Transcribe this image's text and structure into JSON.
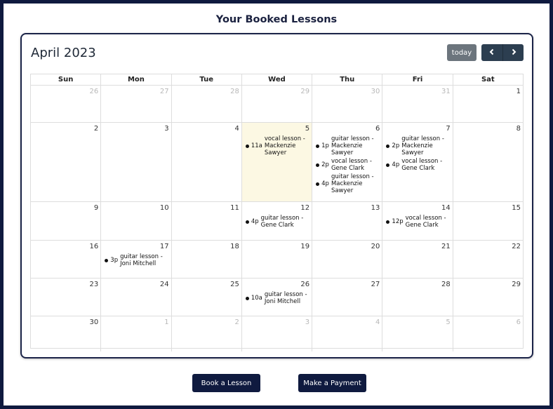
{
  "page": {
    "title": "Your Booked Lessons"
  },
  "calendar": {
    "title": "April 2023",
    "today_label": "today",
    "prev_icon": "chevron-left-icon",
    "next_icon": "chevron-right-icon",
    "days_of_week": [
      "Sun",
      "Mon",
      "Tue",
      "Wed",
      "Thu",
      "Fri",
      "Sat"
    ],
    "weeks": [
      [
        {
          "num": "26",
          "other": true,
          "events": []
        },
        {
          "num": "27",
          "other": true,
          "events": []
        },
        {
          "num": "28",
          "other": true,
          "events": []
        },
        {
          "num": "29",
          "other": true,
          "events": []
        },
        {
          "num": "30",
          "other": true,
          "events": []
        },
        {
          "num": "31",
          "other": true,
          "events": []
        },
        {
          "num": "1",
          "events": []
        }
      ],
      [
        {
          "num": "2",
          "events": []
        },
        {
          "num": "3",
          "events": []
        },
        {
          "num": "4",
          "events": []
        },
        {
          "num": "5",
          "today": true,
          "events": [
            {
              "time": "11a",
              "title": "vocal lesson - Mackenzie Sawyer"
            }
          ]
        },
        {
          "num": "6",
          "events": [
            {
              "time": "1p",
              "title": "guitar lesson - Mackenzie Sawyer"
            },
            {
              "time": "2p",
              "title": "vocal lesson - Gene Clark"
            },
            {
              "time": "4p",
              "title": "guitar lesson - Mackenzie Sawyer"
            }
          ]
        },
        {
          "num": "7",
          "events": [
            {
              "time": "2p",
              "title": "guitar lesson - Mackenzie Sawyer"
            },
            {
              "time": "4p",
              "title": "vocal lesson - Gene Clark"
            }
          ]
        },
        {
          "num": "8",
          "events": []
        }
      ],
      [
        {
          "num": "9",
          "events": []
        },
        {
          "num": "10",
          "events": []
        },
        {
          "num": "11",
          "events": []
        },
        {
          "num": "12",
          "events": [
            {
              "time": "4p",
              "title": "guitar lesson - Gene Clark"
            }
          ]
        },
        {
          "num": "13",
          "events": []
        },
        {
          "num": "14",
          "events": [
            {
              "time": "12p",
              "title": "vocal lesson - Gene Clark"
            }
          ]
        },
        {
          "num": "15",
          "events": []
        }
      ],
      [
        {
          "num": "16",
          "events": []
        },
        {
          "num": "17",
          "events": [
            {
              "time": "3p",
              "title": "guitar lesson - Joni Mitchell"
            }
          ]
        },
        {
          "num": "18",
          "events": []
        },
        {
          "num": "19",
          "events": []
        },
        {
          "num": "20",
          "events": []
        },
        {
          "num": "21",
          "events": []
        },
        {
          "num": "22",
          "events": []
        }
      ],
      [
        {
          "num": "23",
          "events": []
        },
        {
          "num": "24",
          "events": []
        },
        {
          "num": "25",
          "events": []
        },
        {
          "num": "26",
          "events": [
            {
              "time": "10a",
              "title": "guitar lesson - Joni Mitchell"
            }
          ]
        },
        {
          "num": "27",
          "events": []
        },
        {
          "num": "28",
          "events": []
        },
        {
          "num": "29",
          "events": []
        }
      ],
      [
        {
          "num": "30",
          "events": []
        },
        {
          "num": "1",
          "other": true,
          "events": []
        },
        {
          "num": "2",
          "other": true,
          "events": []
        },
        {
          "num": "3",
          "other": true,
          "events": []
        },
        {
          "num": "4",
          "other": true,
          "events": []
        },
        {
          "num": "5",
          "other": true,
          "events": []
        },
        {
          "num": "6",
          "other": true,
          "events": []
        }
      ]
    ]
  },
  "actions": {
    "book_label": "Book a Lesson",
    "pay_label": "Make a Payment"
  }
}
